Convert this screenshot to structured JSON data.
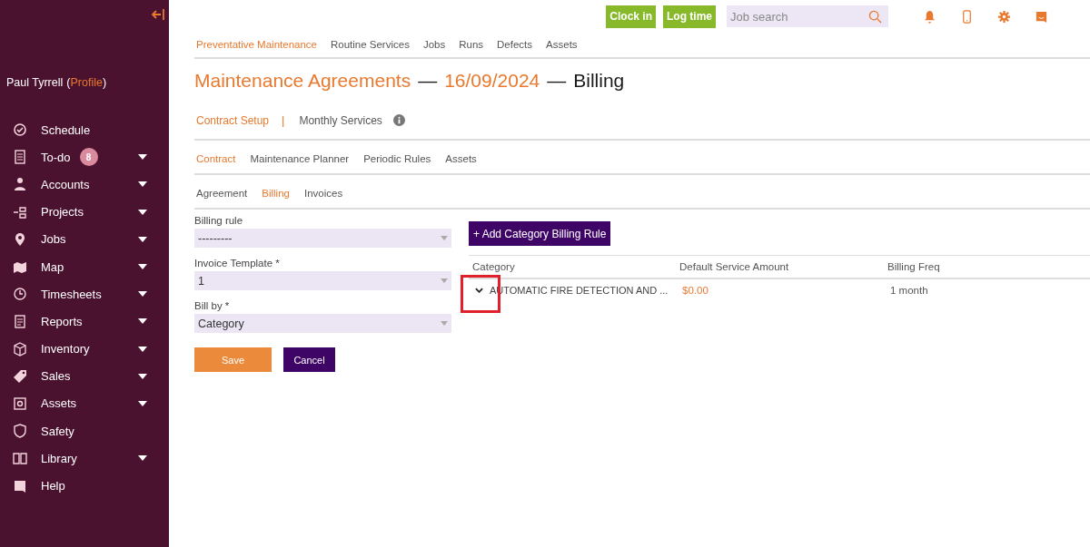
{
  "sidebar": {
    "user": "Paul Tyrrell",
    "profile_link": {
      "open": "(",
      "text": "Profile",
      "close": ")"
    },
    "items": [
      {
        "label": "Schedule",
        "expandable": false
      },
      {
        "label": "To-do",
        "expandable": true,
        "badge": "8"
      },
      {
        "label": "Accounts",
        "expandable": true
      },
      {
        "label": "Projects",
        "expandable": true
      },
      {
        "label": "Jobs",
        "expandable": true
      },
      {
        "label": "Map",
        "expandable": true
      },
      {
        "label": "Timesheets",
        "expandable": true
      },
      {
        "label": "Reports",
        "expandable": true
      },
      {
        "label": "Inventory",
        "expandable": true
      },
      {
        "label": "Sales",
        "expandable": true
      },
      {
        "label": "Assets",
        "expandable": true
      },
      {
        "label": "Safety",
        "expandable": false
      },
      {
        "label": "Library",
        "expandable": true
      },
      {
        "label": "Help",
        "expandable": false
      }
    ]
  },
  "topbar": {
    "buttons": [
      "Clock in",
      "Log time"
    ],
    "search": {
      "placeholder": "Job search"
    }
  },
  "nav_tabs": [
    {
      "label": "Preventative Maintenance",
      "selected": true
    },
    {
      "label": "Routine Services",
      "selected": false
    },
    {
      "label": "Jobs",
      "selected": false
    },
    {
      "label": "Runs",
      "selected": false
    },
    {
      "label": "Defects",
      "selected": false
    },
    {
      "label": "Assets",
      "selected": false
    }
  ],
  "title": [
    {
      "text": "Maintenance Agreements",
      "highlight": true
    },
    {
      "text": "—",
      "highlight": false
    },
    {
      "text": "16/09/2024",
      "highlight": true
    },
    {
      "text": "—",
      "highlight": false
    },
    {
      "text": "Billing",
      "highlight": false
    }
  ],
  "section_tabs": {
    "items": [
      {
        "label": "Contract Setup",
        "selected": true
      },
      {
        "label": "Monthly Services",
        "selected": false
      }
    ],
    "separator": "|"
  },
  "contract_tabs": [
    {
      "label": "Contract",
      "selected": true
    },
    {
      "label": "Maintenance Planner",
      "selected": false
    },
    {
      "label": "Periodic Rules",
      "selected": false
    },
    {
      "label": "Assets",
      "selected": false
    }
  ],
  "billing_tabs": [
    {
      "label": "Agreement",
      "selected": false
    },
    {
      "label": "Billing",
      "selected": true
    },
    {
      "label": "Invoices",
      "selected": false
    }
  ],
  "form": {
    "fields": [
      {
        "label": "Billing rule",
        "value": "---------"
      },
      {
        "label": "Invoice Template *",
        "value": "1"
      },
      {
        "label": "Bill by *",
        "value": "Category"
      }
    ],
    "buttons": [
      {
        "label": "Save",
        "kind": "primary"
      },
      {
        "label": "Cancel",
        "kind": "secondary"
      }
    ]
  },
  "billing_rules": {
    "add_button": "+ Add Category Billing Rule",
    "columns": [
      "Category",
      "Default Service Amount",
      "Billing Freq"
    ],
    "rows": [
      {
        "category": "AUTOMATIC FIRE DETECTION AND ...",
        "amount": "$0.00",
        "frequency": "1 month"
      }
    ]
  }
}
